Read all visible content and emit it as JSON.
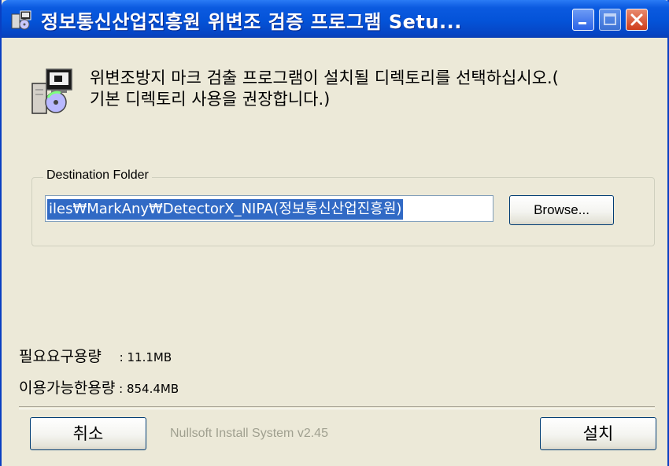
{
  "window": {
    "title": "정보통신산업진흥원 위변조 검증 프로그램 Setu...",
    "controls": {
      "minimize": "minimize",
      "maximize": "maximize",
      "close": "close"
    }
  },
  "header": {
    "line1": "위변조방지 마크 검출 프로그램이 설치될 디렉토리를 선택하십시오.(",
    "line2": "기본 디렉토리 사용을 권장합니다.)"
  },
  "destination": {
    "group_label": "Destination Folder",
    "path": "iles₩MarkAny₩DetectorX_NIPA(정보통신산업진흥원)",
    "browse_label": "Browse..."
  },
  "space": {
    "required_label": "필요요구용량",
    "required_value": " : 11.1MB",
    "available_label": "이용가능한용량",
    "available_value": " : 854.4MB"
  },
  "footer": {
    "cancel_label": "취소",
    "install_label": "설치",
    "branding": "Nullsoft Install System v2.45"
  },
  "icons": [
    "installer-app-icon",
    "minimize-icon",
    "maximize-icon",
    "close-icon",
    "setup-cd-icon"
  ],
  "colors": {
    "titlebar": "#0453d8",
    "selection": "#316ac5",
    "dialog_bg": "#ece9d8",
    "close": "#cf3d1b"
  }
}
